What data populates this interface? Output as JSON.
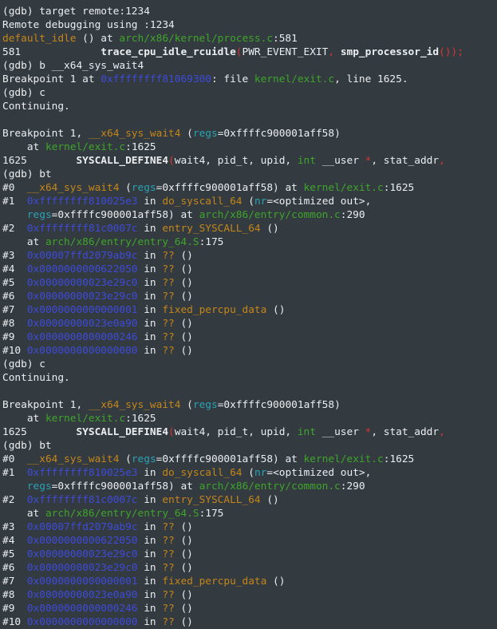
{
  "terminal": {
    "lines": [
      [
        {
          "t": "(gdb) target remote:1234"
        }
      ],
      [
        {
          "t": "Remote debugging using :1234"
        }
      ],
      [
        {
          "t": "default_idle",
          "s": "func"
        },
        {
          "t": " () at "
        },
        {
          "t": "arch/x86/kernel/process.c",
          "s": "file"
        },
        {
          "t": ":581"
        }
      ],
      [
        {
          "t": "581             "
        },
        {
          "t": "trace_cpu_idle_rcuidle",
          "s": "bold"
        },
        {
          "t": "(",
          "s": "red"
        },
        {
          "t": "PWR_EVENT_EXIT"
        },
        {
          "t": ",",
          "s": "red"
        },
        {
          "t": " "
        },
        {
          "t": "smp_processor_id",
          "s": "bold"
        },
        {
          "t": "());",
          "s": "red"
        }
      ],
      [
        {
          "t": "(gdb) b __x64_sys_wait4"
        }
      ],
      [
        {
          "t": "Breakpoint 1 at "
        },
        {
          "t": "0xffffffff81069300",
          "s": "addr"
        },
        {
          "t": ": file "
        },
        {
          "t": "kernel/exit.c",
          "s": "file"
        },
        {
          "t": ", line 1625."
        }
      ],
      [
        {
          "t": "(gdb) c"
        }
      ],
      [
        {
          "t": "Continuing."
        }
      ],
      [
        {
          "t": ""
        }
      ],
      [
        {
          "t": "Breakpoint 1, "
        },
        {
          "t": "__x64_sys_wait4",
          "s": "func"
        },
        {
          "t": " ("
        },
        {
          "t": "regs",
          "s": "arg"
        },
        {
          "t": "=0xffffc900001aff58)"
        }
      ],
      [
        {
          "t": "    at "
        },
        {
          "t": "kernel/exit.c",
          "s": "file"
        },
        {
          "t": ":1625"
        }
      ],
      [
        {
          "t": "1625        "
        },
        {
          "t": "SYSCALL_DEFINE4",
          "s": "bold"
        },
        {
          "t": "(",
          "s": "red"
        },
        {
          "t": "wait4, pid_t, upid, "
        },
        {
          "t": "int",
          "s": "type"
        },
        {
          "t": " __user "
        },
        {
          "t": "*",
          "s": "red"
        },
        {
          "t": ", stat_addr"
        },
        {
          "t": ",",
          "s": "red"
        }
      ],
      [
        {
          "t": "(gdb) bt"
        }
      ],
      [
        {
          "t": "#0  "
        },
        {
          "t": "__x64_sys_wait4",
          "s": "func"
        },
        {
          "t": " ("
        },
        {
          "t": "regs",
          "s": "arg"
        },
        {
          "t": "=0xffffc900001aff58) at "
        },
        {
          "t": "kernel/exit.c",
          "s": "file"
        },
        {
          "t": ":1625"
        }
      ],
      [
        {
          "t": "#1  "
        },
        {
          "t": "0xffffffff810025e3",
          "s": "addr"
        },
        {
          "t": " in "
        },
        {
          "t": "do_syscall_64",
          "s": "func"
        },
        {
          "t": " ("
        },
        {
          "t": "nr",
          "s": "arg"
        },
        {
          "t": "=<optimized out>,"
        }
      ],
      [
        {
          "t": "    "
        },
        {
          "t": "regs",
          "s": "arg"
        },
        {
          "t": "=0xffffc900001aff58) at "
        },
        {
          "t": "arch/x86/entry/common.c",
          "s": "file"
        },
        {
          "t": ":290"
        }
      ],
      [
        {
          "t": "#2  "
        },
        {
          "t": "0xffffffff81c0007c",
          "s": "addr"
        },
        {
          "t": " in "
        },
        {
          "t": "entry_SYSCALL_64",
          "s": "func"
        },
        {
          "t": " ()"
        }
      ],
      [
        {
          "t": "    at "
        },
        {
          "t": "arch/x86/entry/entry_64.S",
          "s": "file"
        },
        {
          "t": ":175"
        }
      ],
      [
        {
          "t": "#3  "
        },
        {
          "t": "0x00007ffd2079ab9c",
          "s": "addr"
        },
        {
          "t": " in "
        },
        {
          "t": "??",
          "s": "func"
        },
        {
          "t": " ()"
        }
      ],
      [
        {
          "t": "#4  "
        },
        {
          "t": "0x0000000000622050",
          "s": "addr"
        },
        {
          "t": " in "
        },
        {
          "t": "??",
          "s": "func"
        },
        {
          "t": " ()"
        }
      ],
      [
        {
          "t": "#5  "
        },
        {
          "t": "0x00000000023e29c0",
          "s": "addr"
        },
        {
          "t": " in "
        },
        {
          "t": "??",
          "s": "func"
        },
        {
          "t": " ()"
        }
      ],
      [
        {
          "t": "#6  "
        },
        {
          "t": "0x00000000023e29c0",
          "s": "addr"
        },
        {
          "t": " in "
        },
        {
          "t": "??",
          "s": "func"
        },
        {
          "t": " ()"
        }
      ],
      [
        {
          "t": "#7  "
        },
        {
          "t": "0x0000000000000001",
          "s": "addr"
        },
        {
          "t": " in "
        },
        {
          "t": "fixed_percpu_data",
          "s": "func"
        },
        {
          "t": " ()"
        }
      ],
      [
        {
          "t": "#8  "
        },
        {
          "t": "0x00000000023e0a90",
          "s": "addr"
        },
        {
          "t": " in "
        },
        {
          "t": "??",
          "s": "func"
        },
        {
          "t": " ()"
        }
      ],
      [
        {
          "t": "#9  "
        },
        {
          "t": "0x0000000000000246",
          "s": "addr"
        },
        {
          "t": " in "
        },
        {
          "t": "??",
          "s": "func"
        },
        {
          "t": " ()"
        }
      ],
      [
        {
          "t": "#10 "
        },
        {
          "t": "0x0000000000000000",
          "s": "addr"
        },
        {
          "t": " in "
        },
        {
          "t": "??",
          "s": "func"
        },
        {
          "t": " ()"
        }
      ],
      [
        {
          "t": "(gdb) c"
        }
      ],
      [
        {
          "t": "Continuing."
        }
      ],
      [
        {
          "t": ""
        }
      ],
      [
        {
          "t": "Breakpoint 1, "
        },
        {
          "t": "__x64_sys_wait4",
          "s": "func"
        },
        {
          "t": " ("
        },
        {
          "t": "regs",
          "s": "arg"
        },
        {
          "t": "=0xffffc900001aff58)"
        }
      ],
      [
        {
          "t": "    at "
        },
        {
          "t": "kernel/exit.c",
          "s": "file"
        },
        {
          "t": ":1625"
        }
      ],
      [
        {
          "t": "1625        "
        },
        {
          "t": "SYSCALL_DEFINE4",
          "s": "bold"
        },
        {
          "t": "(",
          "s": "red"
        },
        {
          "t": "wait4, pid_t, upid, "
        },
        {
          "t": "int",
          "s": "type"
        },
        {
          "t": " __user "
        },
        {
          "t": "*",
          "s": "red"
        },
        {
          "t": ", stat_addr"
        },
        {
          "t": ",",
          "s": "red"
        }
      ],
      [
        {
          "t": "(gdb) bt"
        }
      ],
      [
        {
          "t": "#0  "
        },
        {
          "t": "__x64_sys_wait4",
          "s": "func"
        },
        {
          "t": " ("
        },
        {
          "t": "regs",
          "s": "arg"
        },
        {
          "t": "=0xffffc900001aff58) at "
        },
        {
          "t": "kernel/exit.c",
          "s": "file"
        },
        {
          "t": ":1625"
        }
      ],
      [
        {
          "t": "#1  "
        },
        {
          "t": "0xffffffff810025e3",
          "s": "addr"
        },
        {
          "t": " in "
        },
        {
          "t": "do_syscall_64",
          "s": "func"
        },
        {
          "t": " ("
        },
        {
          "t": "nr",
          "s": "arg"
        },
        {
          "t": "=<optimized out>,"
        }
      ],
      [
        {
          "t": "    "
        },
        {
          "t": "regs",
          "s": "arg"
        },
        {
          "t": "=0xffffc900001aff58) at "
        },
        {
          "t": "arch/x86/entry/common.c",
          "s": "file"
        },
        {
          "t": ":290"
        }
      ],
      [
        {
          "t": "#2  "
        },
        {
          "t": "0xffffffff81c0007c",
          "s": "addr"
        },
        {
          "t": " in "
        },
        {
          "t": "entry_SYSCALL_64",
          "s": "func"
        },
        {
          "t": " ()"
        }
      ],
      [
        {
          "t": "    at "
        },
        {
          "t": "arch/x86/entry/entry_64.S",
          "s": "file"
        },
        {
          "t": ":175"
        }
      ],
      [
        {
          "t": "#3  "
        },
        {
          "t": "0x00007ffd2079ab9c",
          "s": "addr"
        },
        {
          "t": " in "
        },
        {
          "t": "??",
          "s": "func"
        },
        {
          "t": " ()"
        }
      ],
      [
        {
          "t": "#4  "
        },
        {
          "t": "0x0000000000622050",
          "s": "addr"
        },
        {
          "t": " in "
        },
        {
          "t": "??",
          "s": "func"
        },
        {
          "t": " ()"
        }
      ],
      [
        {
          "t": "#5  "
        },
        {
          "t": "0x00000000023e29c0",
          "s": "addr"
        },
        {
          "t": " in "
        },
        {
          "t": "??",
          "s": "func"
        },
        {
          "t": " ()"
        }
      ],
      [
        {
          "t": "#6  "
        },
        {
          "t": "0x00000000023e29c0",
          "s": "addr"
        },
        {
          "t": " in "
        },
        {
          "t": "??",
          "s": "func"
        },
        {
          "t": " ()"
        }
      ],
      [
        {
          "t": "#7  "
        },
        {
          "t": "0x0000000000000001",
          "s": "addr"
        },
        {
          "t": " in "
        },
        {
          "t": "fixed_percpu_data",
          "s": "func"
        },
        {
          "t": " ()"
        }
      ],
      [
        {
          "t": "#8  "
        },
        {
          "t": "0x00000000023e0a90",
          "s": "addr"
        },
        {
          "t": " in "
        },
        {
          "t": "??",
          "s": "func"
        },
        {
          "t": " ()"
        }
      ],
      [
        {
          "t": "#9  "
        },
        {
          "t": "0x0000000000000246",
          "s": "addr"
        },
        {
          "t": " in "
        },
        {
          "t": "??",
          "s": "func"
        },
        {
          "t": " ()"
        }
      ],
      [
        {
          "t": "#10 "
        },
        {
          "t": "0x0000000000000000",
          "s": "addr"
        },
        {
          "t": " in "
        },
        {
          "t": "??",
          "s": "func"
        },
        {
          "t": " ()"
        }
      ]
    ]
  },
  "colors": {
    "background": "#333a40",
    "text": "#eceff1",
    "address": "#3f4bd8",
    "function": "#c5861a",
    "file": "#3fa52a",
    "argument": "#2aa3b4",
    "keyword": "#3fa52a",
    "punctuation": "#d63636"
  }
}
